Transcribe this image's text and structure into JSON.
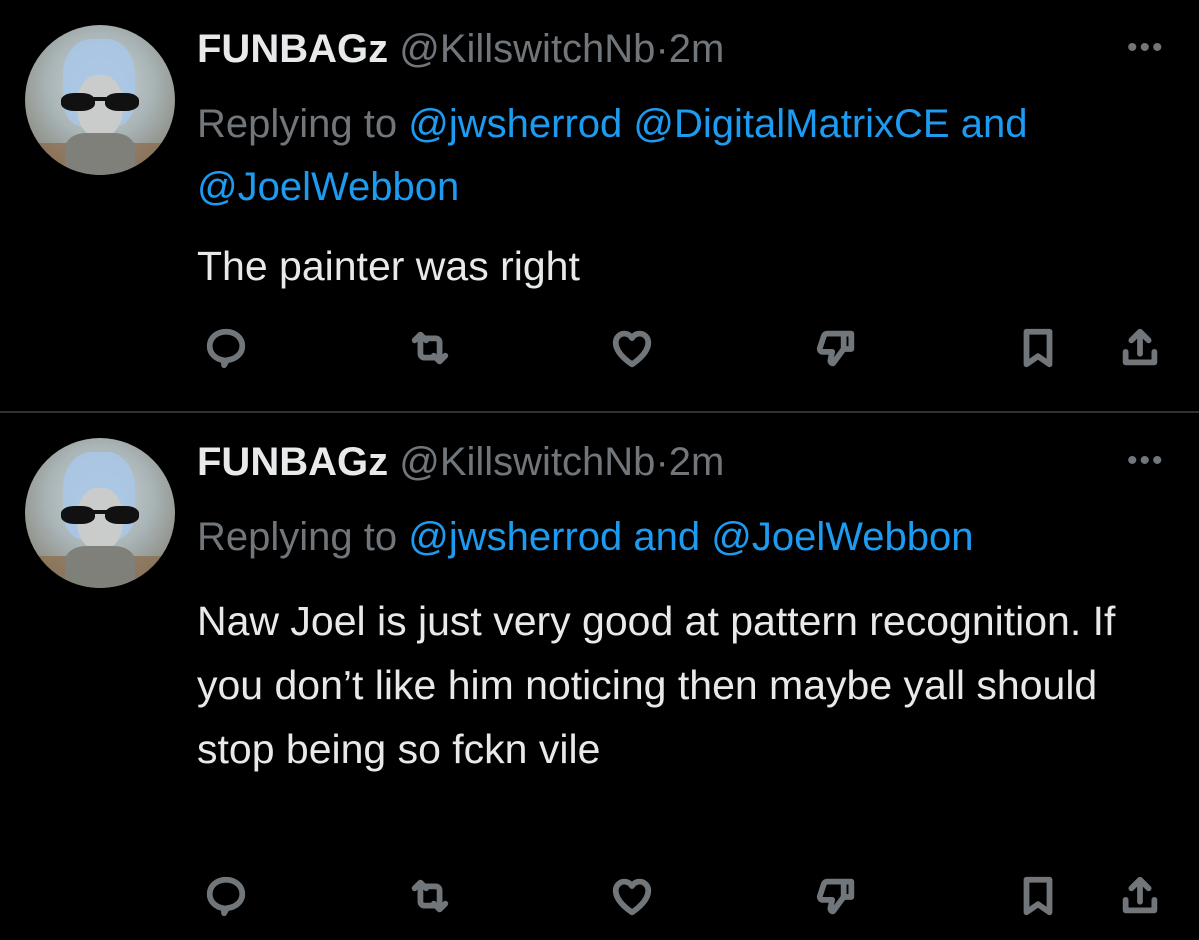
{
  "tweets": [
    {
      "name": "FUNBAGz",
      "handle": "@KillswitchNb",
      "dot": "·",
      "time": "2m",
      "more": "•••",
      "replying_prefix": "Replying to",
      "mention_1": "@jwsherrod",
      "mention_2": "@DigitalMatrixCE",
      "and_text": "and",
      "mention_3": "@JoelWebbon",
      "text": "The painter was right"
    },
    {
      "name": "FUNBAGz",
      "handle": "@KillswitchNb",
      "dot": "·",
      "time": "2m",
      "more": "•••",
      "replying_prefix": "Replying to",
      "mention_1": "@jwsherrod",
      "and_text": "and",
      "mention_2": "@JoelWebbon",
      "text": "Naw Joel is just very good at pattern recognition.  If you don’t like him noticing then maybe yall should stop being so fckn vile"
    }
  ],
  "actions": [
    "reply-icon",
    "retweet-icon",
    "like-icon",
    "dislike-icon",
    "bookmark-icon",
    "share-icon"
  ],
  "colors": {
    "background": "#000000",
    "text": "#e7e9ea",
    "muted": "#71767b",
    "link": "#1d9bf0",
    "divider": "#2f3336"
  }
}
